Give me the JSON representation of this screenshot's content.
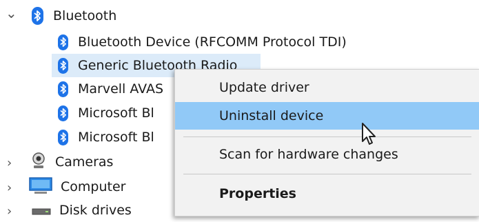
{
  "tree": {
    "bluetooth": {
      "label": "Bluetooth",
      "children": [
        "Bluetooth Device (RFCOMM Protocol TDI)",
        "Generic Bluetooth Radio",
        "Marvell AVAS",
        "Microsoft Bl",
        "Microsoft Bl"
      ]
    },
    "cameras": "Cameras",
    "computer": "Computer",
    "disk_drives": "Disk drives"
  },
  "context_menu": {
    "update_driver": "Update driver",
    "uninstall_device": "Uninstall device",
    "scan_hardware": "Scan for hardware changes",
    "properties": "Properties"
  },
  "colors": {
    "bluetooth_blue": "#1e73e8",
    "selection": "#dcebf9",
    "menu_highlight": "#91c9f7",
    "menu_bg": "#f2f2f2"
  }
}
